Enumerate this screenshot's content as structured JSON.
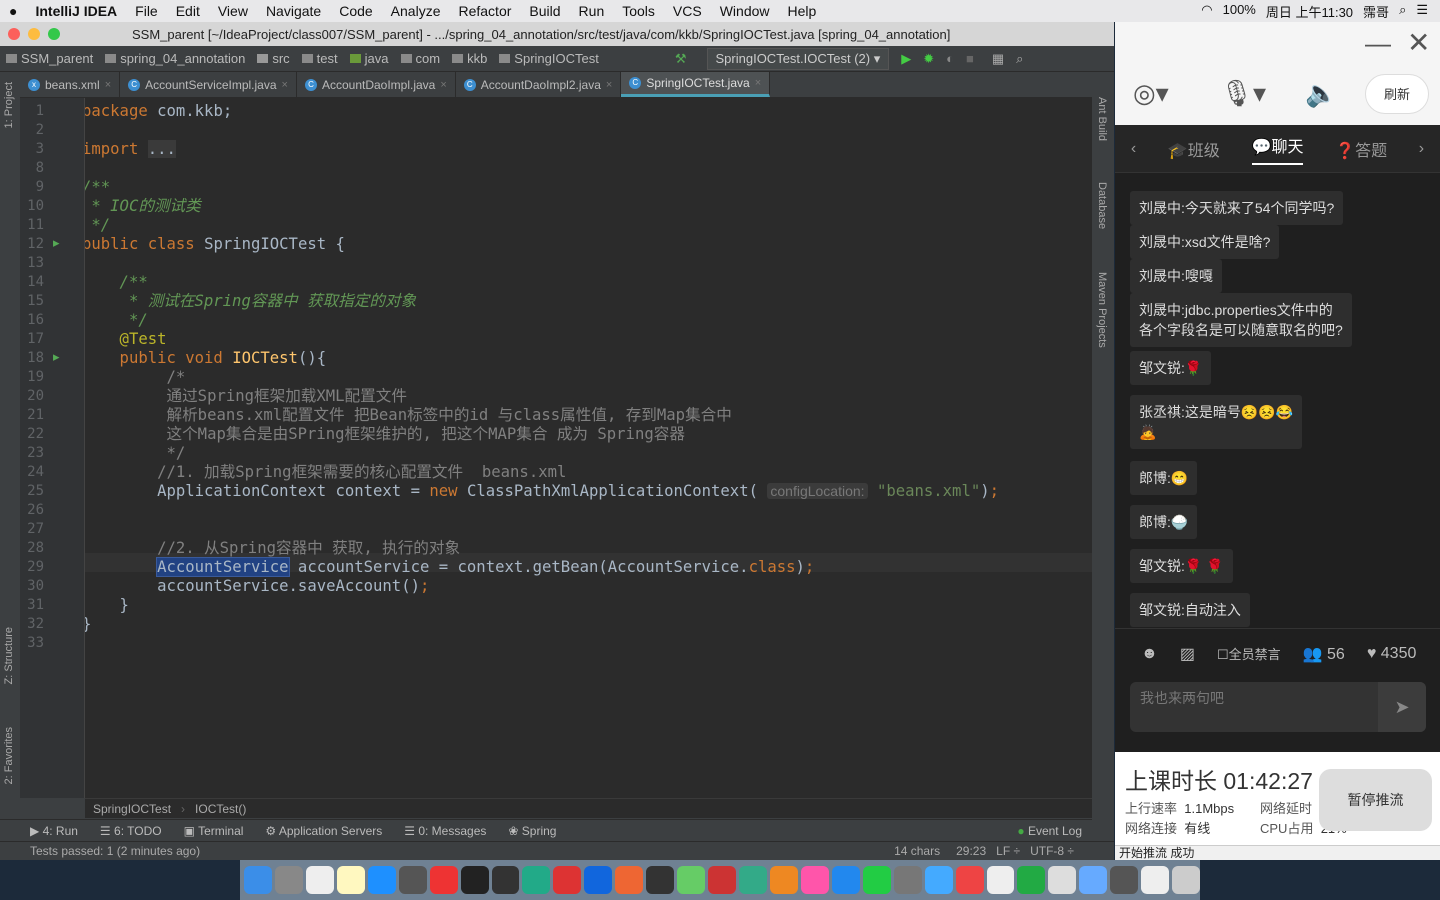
{
  "menubar": {
    "app": "IntelliJ IDEA",
    "items": [
      "File",
      "Edit",
      "View",
      "Navigate",
      "Code",
      "Analyze",
      "Refactor",
      "Build",
      "Run",
      "Tools",
      "VCS",
      "Window",
      "Help"
    ],
    "battery": "100%",
    "clock": "周日 上午11:30",
    "user": "霈哥"
  },
  "window": {
    "title": "SSM_parent [~/IdeaProject/class007/SSM_parent] - .../spring_04_annotation/src/test/java/com/kkb/SpringIOCTest.java [spring_04_annotation]"
  },
  "navbar": {
    "crumbs": [
      "SSM_parent",
      "spring_04_annotation",
      "src",
      "test",
      "java",
      "com",
      "kkb",
      "SpringIOCTest"
    ],
    "run_config": "SpringIOCTest.IOCTest (2)"
  },
  "tabs": [
    {
      "label": "beans.xml"
    },
    {
      "label": "AccountServiceImpl.java"
    },
    {
      "label": "AccountDaoImpl.java"
    },
    {
      "label": "AccountDaoImpl2.java"
    },
    {
      "label": "SpringIOCTest.java",
      "active": true
    }
  ],
  "left_strip": {
    "project": "1: Project",
    "structure": "Z: Structure",
    "favorites": "2: Favorites"
  },
  "right_strip": {
    "ant": "Ant Build",
    "database": "Database",
    "maven": "Maven Projects"
  },
  "code": {
    "lines": [
      {
        "n": "1",
        "t": [
          [
            "kw",
            "package "
          ],
          [
            "",
            "com.kkb;"
          ]
        ]
      },
      {
        "n": "2",
        "t": []
      },
      {
        "n": "3",
        "t": [
          [
            "kw",
            "import "
          ],
          [
            "fold",
            "..."
          ]
        ]
      },
      {
        "n": "8",
        "t": []
      },
      {
        "n": "9",
        "t": [
          [
            "doci",
            "/**"
          ]
        ]
      },
      {
        "n": "10",
        "t": [
          [
            "doci",
            " * IOC的测试类"
          ]
        ]
      },
      {
        "n": "11",
        "t": [
          [
            "doci",
            " */"
          ]
        ]
      },
      {
        "n": "12",
        "t": [
          [
            "kw",
            "public class "
          ],
          [
            "",
            "SpringIOCTest {"
          ]
        ]
      },
      {
        "n": "13",
        "t": []
      },
      {
        "n": "14",
        "t": [
          [
            "doci",
            "    /**"
          ]
        ]
      },
      {
        "n": "15",
        "t": [
          [
            "doci",
            "     * 测试在Spring容器中 获取指定的对象"
          ]
        ]
      },
      {
        "n": "16",
        "t": [
          [
            "doci",
            "     */"
          ]
        ]
      },
      {
        "n": "17",
        "t": [
          [
            "an",
            "    @Test"
          ]
        ]
      },
      {
        "n": "18",
        "t": [
          [
            "kw",
            "    public void "
          ],
          [
            "fn",
            "IOCTest"
          ],
          [
            "",
            "(){"
          ]
        ]
      },
      {
        "n": "19",
        "t": [
          [
            "cm",
            "         /*"
          ]
        ]
      },
      {
        "n": "20",
        "t": [
          [
            "cm",
            "         通过Spring框架加载XML配置文件"
          ]
        ]
      },
      {
        "n": "21",
        "t": [
          [
            "cm",
            "         解析beans.xml配置文件 把Bean标签中的id 与class属性值, 存到Map集合中"
          ]
        ]
      },
      {
        "n": "22",
        "t": [
          [
            "cm",
            "         这个Map集合是由SPring框架维护的, 把这个MAP集合 成为 Spring容器"
          ]
        ]
      },
      {
        "n": "23",
        "t": [
          [
            "cm",
            "         */"
          ]
        ]
      },
      {
        "n": "24",
        "t": [
          [
            "cm",
            "        //1. 加载Spring框架需要的核心配置文件  beans.xml"
          ]
        ]
      },
      {
        "n": "25",
        "t": [
          [
            "",
            "        ApplicationContext context = "
          ],
          [
            "kw",
            "new "
          ],
          [
            "",
            "ClassPathXmlApplicationContext( "
          ],
          [
            "hint",
            "configLocation:"
          ],
          [
            "str",
            " \"beans.xml\""
          ],
          [
            "",
            ")"
          ],
          [
            "kw",
            ";"
          ]
        ]
      },
      {
        "n": "26",
        "t": []
      },
      {
        "n": "27",
        "t": []
      },
      {
        "n": "28",
        "t": [
          [
            "cm",
            "        //2. 从Spring容器中 获取, 执行的对象"
          ]
        ]
      },
      {
        "n": "29",
        "t": [
          [
            "",
            "        "
          ],
          [
            "sel",
            "AccountService"
          ],
          [
            "",
            " accountService = context.getBean(AccountService."
          ],
          [
            "kw",
            "class"
          ],
          [
            "",
            ")"
          ],
          [
            "kw",
            ";"
          ]
        ]
      },
      {
        "n": "30",
        "t": [
          [
            "",
            "        accountService.saveAccount()"
          ],
          [
            "kw",
            ";"
          ]
        ]
      },
      {
        "n": "31",
        "t": [
          [
            "",
            "    }"
          ]
        ]
      },
      {
        "n": "32",
        "t": [
          [
            "",
            "}"
          ]
        ]
      },
      {
        "n": "33",
        "t": []
      }
    ]
  },
  "breadcrumb": [
    "SpringIOCTest",
    "IOCTest()"
  ],
  "toolwindows": [
    "4: Run",
    "6: TODO",
    "Terminal",
    "Application Servers",
    "0: Messages",
    "Spring"
  ],
  "event_log": "Event Log",
  "status": {
    "message": "Tests passed: 1 (2 minutes ago)",
    "chars": "14 chars",
    "position": "29:23",
    "line_sep": "LF ÷",
    "encoding": "UTF-8 ÷"
  },
  "panel": {
    "refresh": "刷新",
    "tabs": [
      "班级",
      "聊天",
      "答题"
    ],
    "messages": [
      {
        "who": "刘晟中:",
        "text": "今天就来了54个同学吗?"
      },
      {
        "who": "刘晟中:",
        "text": "xsd文件是啥?"
      },
      {
        "who": "刘晟中:",
        "text": "嗖嘎"
      },
      {
        "who": "刘晟中:",
        "text": "jdbc.properties文件中的\n各个字段名是可以随意取名的吧?"
      },
      {
        "who": "邹文锐:",
        "text": "🌹"
      },
      {
        "who": "张丞祺:",
        "text": "这是暗号😣😣😂\n🙇"
      },
      {
        "who": "郎博:",
        "text": "😁"
      },
      {
        "who": "郎博:",
        "text": "🍚"
      },
      {
        "who": "邹文锐:",
        "text": "🌹 🌹"
      },
      {
        "who": "邹文锐:",
        "text": "自动注入"
      }
    ],
    "mute_all": "全员禁言",
    "online": "56",
    "likes": "4350",
    "input_placeholder": "我也来两句吧",
    "duration_label": "上课时长",
    "duration": "01:42:27",
    "upload_label": "上行速率",
    "upload": "1.1Mbps",
    "latency_label": "网络延时",
    "conn_label": "网络连接",
    "conn": "有线",
    "cpu_label": "CPU占用",
    "cpu": "21%",
    "pause": "暂停推流",
    "stream_status": "开始推流 成功"
  },
  "dock_colors": [
    "#3b8ee8",
    "#888",
    "#eee",
    "#fff8c0",
    "#1e90ff",
    "#555",
    "#e33",
    "#222",
    "#333",
    "#2a8",
    "#d33",
    "#16d",
    "#e63",
    "#333",
    "#6c6",
    "#c33",
    "#3a8",
    "#e82",
    "#f5a",
    "#28e",
    "#2c4",
    "#777",
    "#4af",
    "#e44",
    "#eee",
    "#2a4",
    "#ddd",
    "#6af",
    "#555",
    "#eee",
    "#ccc"
  ]
}
